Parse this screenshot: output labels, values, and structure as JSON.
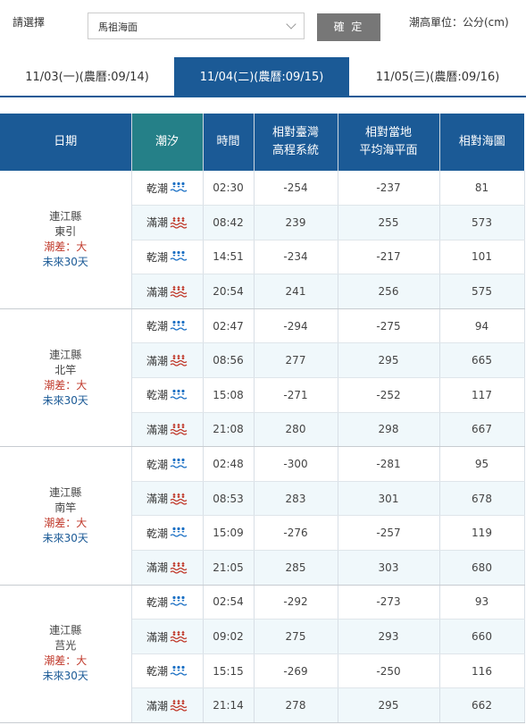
{
  "controls": {
    "select_label": "請選擇",
    "selected_area": "馬祖海面",
    "confirm_label": "確 定",
    "unit_text": "潮高單位：公分(cm)"
  },
  "tabs": [
    {
      "label": "11/03(一)(農曆:09/14)",
      "active": false
    },
    {
      "label": "11/04(二)(農曆:09/15)",
      "active": true
    },
    {
      "label": "11/05(三)(農曆:09/16)",
      "active": false
    }
  ],
  "table": {
    "headers": {
      "date": "日期",
      "tide": "潮汐",
      "time": "時間",
      "twvd_line1": "相對臺灣",
      "twvd_line2": "高程系統",
      "msl_line1": "相對當地",
      "msl_line2": "平均海平面",
      "chart": "相對海圖"
    },
    "locations": [
      {
        "county": "連江縣",
        "name": "東引",
        "diff": "潮差：大",
        "future": "未來30天",
        "rows": [
          {
            "type": "乾潮",
            "kind": "low",
            "time": "02:30",
            "twvd": "-254",
            "msl": "-237",
            "chart": "81"
          },
          {
            "type": "滿潮",
            "kind": "high",
            "time": "08:42",
            "twvd": "239",
            "msl": "255",
            "chart": "573"
          },
          {
            "type": "乾潮",
            "kind": "low",
            "time": "14:51",
            "twvd": "-234",
            "msl": "-217",
            "chart": "101"
          },
          {
            "type": "滿潮",
            "kind": "high",
            "time": "20:54",
            "twvd": "241",
            "msl": "256",
            "chart": "575"
          }
        ]
      },
      {
        "county": "連江縣",
        "name": "北竿",
        "diff": "潮差：大",
        "future": "未來30天",
        "rows": [
          {
            "type": "乾潮",
            "kind": "low",
            "time": "02:47",
            "twvd": "-294",
            "msl": "-275",
            "chart": "94"
          },
          {
            "type": "滿潮",
            "kind": "high",
            "time": "08:56",
            "twvd": "277",
            "msl": "295",
            "chart": "665"
          },
          {
            "type": "乾潮",
            "kind": "low",
            "time": "15:08",
            "twvd": "-271",
            "msl": "-252",
            "chart": "117"
          },
          {
            "type": "滿潮",
            "kind": "high",
            "time": "21:08",
            "twvd": "280",
            "msl": "298",
            "chart": "667"
          }
        ]
      },
      {
        "county": "連江縣",
        "name": "南竿",
        "diff": "潮差：大",
        "future": "未來30天",
        "rows": [
          {
            "type": "乾潮",
            "kind": "low",
            "time": "02:48",
            "twvd": "-300",
            "msl": "-281",
            "chart": "95"
          },
          {
            "type": "滿潮",
            "kind": "high",
            "time": "08:53",
            "twvd": "283",
            "msl": "301",
            "chart": "678"
          },
          {
            "type": "乾潮",
            "kind": "low",
            "time": "15:09",
            "twvd": "-276",
            "msl": "-257",
            "chart": "119"
          },
          {
            "type": "滿潮",
            "kind": "high",
            "time": "21:05",
            "twvd": "285",
            "msl": "303",
            "chart": "680"
          }
        ]
      },
      {
        "county": "連江縣",
        "name": "莒光",
        "diff": "潮差：大",
        "future": "未來30天",
        "rows": [
          {
            "type": "乾潮",
            "kind": "low",
            "time": "02:54",
            "twvd": "-292",
            "msl": "-273",
            "chart": "93"
          },
          {
            "type": "滿潮",
            "kind": "high",
            "time": "09:02",
            "twvd": "275",
            "msl": "293",
            "chart": "660"
          },
          {
            "type": "乾潮",
            "kind": "low",
            "time": "15:15",
            "twvd": "-269",
            "msl": "-250",
            "chart": "116"
          },
          {
            "type": "滿潮",
            "kind": "high",
            "time": "21:14",
            "twvd": "278",
            "msl": "295",
            "chart": "662"
          }
        ]
      }
    ]
  },
  "icons": {
    "low": "low-tide-icon",
    "high": "high-tide-icon"
  },
  "colors": {
    "primary_blue": "#1b5a96",
    "tide_header_teal": "#258088",
    "low_tide_icon": "#1a6fc4",
    "high_tide_icon": "#c0392b",
    "diff_text": "#c0392b"
  }
}
